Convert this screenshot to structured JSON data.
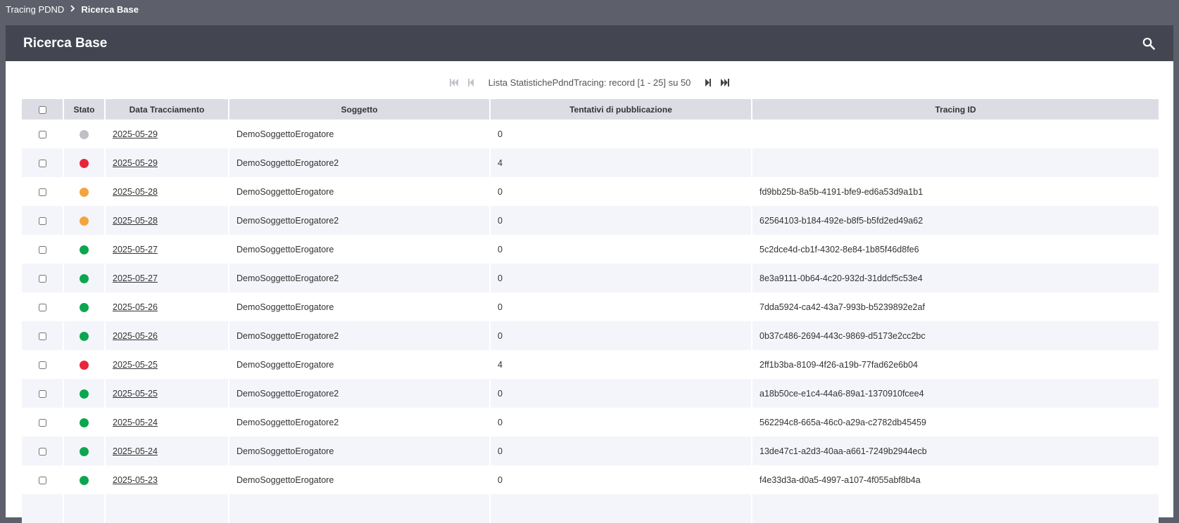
{
  "breadcrumb": {
    "parent": "Tracing PDND",
    "current": "Ricerca Base"
  },
  "panel": {
    "title": "Ricerca Base",
    "search_icon": "search-icon"
  },
  "pager": {
    "info": "Lista StatistichePdndTracing: record [1 - 25] su 50"
  },
  "table": {
    "columns": [
      "",
      "Stato",
      "Data Tracciamento",
      "Soggetto",
      "Tentativi di pubblicazione",
      "Tracing ID"
    ],
    "status_colors": {
      "grey": "#bfc0c6",
      "red": "#e8273a",
      "orange": "#f4a43c",
      "green": "#0ca650"
    },
    "rows": [
      {
        "status": "grey",
        "date": "2025-05-29",
        "soggetto": "DemoSoggettoErogatore",
        "tentativi": "0",
        "tracing_id": ""
      },
      {
        "status": "red",
        "date": "2025-05-29",
        "soggetto": "DemoSoggettoErogatore2",
        "tentativi": "4",
        "tracing_id": ""
      },
      {
        "status": "orange",
        "date": "2025-05-28",
        "soggetto": "DemoSoggettoErogatore",
        "tentativi": "0",
        "tracing_id": "fd9bb25b-8a5b-4191-bfe9-ed6a53d9a1b1"
      },
      {
        "status": "orange",
        "date": "2025-05-28",
        "soggetto": "DemoSoggettoErogatore2",
        "tentativi": "0",
        "tracing_id": "62564103-b184-492e-b8f5-b5fd2ed49a62"
      },
      {
        "status": "green",
        "date": "2025-05-27",
        "soggetto": "DemoSoggettoErogatore",
        "tentativi": "0",
        "tracing_id": "5c2dce4d-cb1f-4302-8e84-1b85f46d8fe6"
      },
      {
        "status": "green",
        "date": "2025-05-27",
        "soggetto": "DemoSoggettoErogatore2",
        "tentativi": "0",
        "tracing_id": "8e3a9111-0b64-4c20-932d-31ddcf5c53e4"
      },
      {
        "status": "green",
        "date": "2025-05-26",
        "soggetto": "DemoSoggettoErogatore",
        "tentativi": "0",
        "tracing_id": "7dda5924-ca42-43a7-993b-b5239892e2af"
      },
      {
        "status": "green",
        "date": "2025-05-26",
        "soggetto": "DemoSoggettoErogatore2",
        "tentativi": "0",
        "tracing_id": "0b37c486-2694-443c-9869-d5173e2cc2bc"
      },
      {
        "status": "red",
        "date": "2025-05-25",
        "soggetto": "DemoSoggettoErogatore",
        "tentativi": "4",
        "tracing_id": "2ff1b3ba-8109-4f26-a19b-77fad62e6b04"
      },
      {
        "status": "green",
        "date": "2025-05-25",
        "soggetto": "DemoSoggettoErogatore2",
        "tentativi": "0",
        "tracing_id": "a18b50ce-e1c4-44a6-89a1-1370910fcee4"
      },
      {
        "status": "green",
        "date": "2025-05-24",
        "soggetto": "DemoSoggettoErogatore2",
        "tentativi": "0",
        "tracing_id": "562294c8-665a-46c0-a29a-c2782db45459"
      },
      {
        "status": "green",
        "date": "2025-05-24",
        "soggetto": "DemoSoggettoErogatore",
        "tentativi": "0",
        "tracing_id": "13de47c1-a2d3-40aa-a661-7249b2944ecb"
      },
      {
        "status": "green",
        "date": "2025-05-23",
        "soggetto": "DemoSoggettoErogatore",
        "tentativi": "0",
        "tracing_id": "f4e33d3a-d0a5-4997-a107-4f055abf8b4a"
      }
    ]
  }
}
